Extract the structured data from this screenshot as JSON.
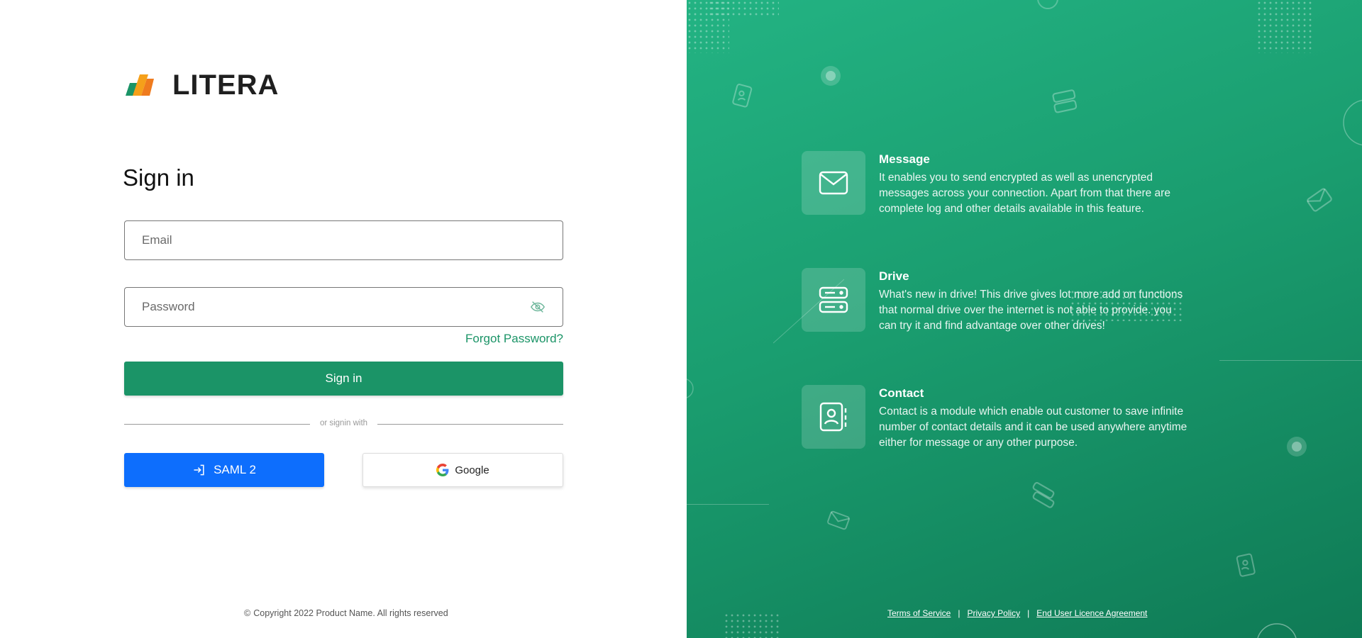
{
  "brand": {
    "name": "LITERA"
  },
  "form": {
    "title": "Sign in",
    "email_placeholder": "Email",
    "password_placeholder": "Password",
    "forgot_label": "Forgot Password?",
    "signin_label": "Sign in",
    "divider_text": "or signin with",
    "saml_label": "SAML 2",
    "google_label": "Google"
  },
  "footer": {
    "copyright": "Copyright 2022 Product Name. All rights reserved",
    "links": [
      "Terms of Service",
      "Privacy Policy",
      "End User Licence Agreement"
    ]
  },
  "features": [
    {
      "icon": "envelope-icon",
      "title": "Message",
      "description": "It enables you to send encrypted as well as unencrypted messages across your connection. Apart from that there are complete log and other details available in this feature."
    },
    {
      "icon": "server-icon",
      "title": "Drive",
      "description": "What's new in drive! This drive gives lot more add on functions that normal drive over the internet is not able to provide. you can try it and find advantage over other drives!"
    },
    {
      "icon": "contact-book-icon",
      "title": "Contact",
      "description": "Contact is a module which enable out customer to save infinite number of contact details and it can be used anywhere anytime either for message or any other purpose."
    }
  ],
  "colors": {
    "primary": "#1b9467",
    "saml": "#0d6efd",
    "panel_start": "#23b383",
    "panel_end": "#0f7a55"
  }
}
